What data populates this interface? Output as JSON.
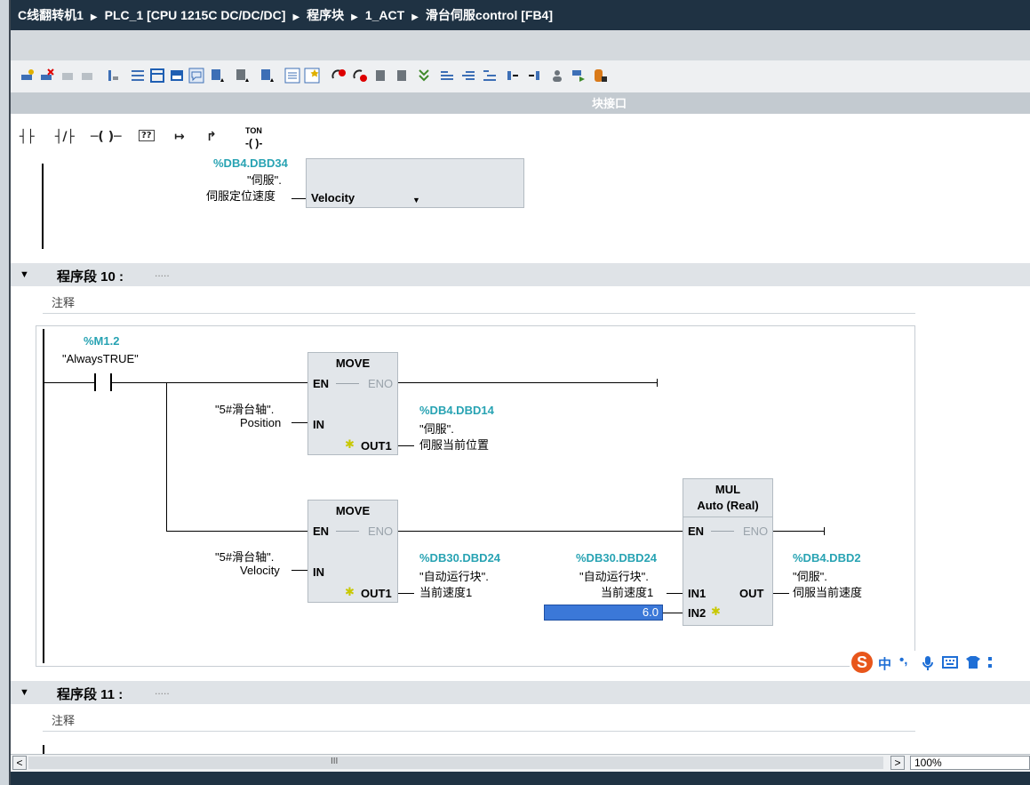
{
  "breadcrumb": {
    "project": "C线翻转机1",
    "plc": "PLC_1 [CPU 1215C DC/DC/DC]",
    "folder": "程序块",
    "group": "1_ACT",
    "block": "滑台伺服control [FB4]",
    "separator": "▶"
  },
  "interface_bar": {
    "label": "块接口"
  },
  "ladder_tools": {
    "no_contact": "┤├",
    "nc_contact": "┤/├",
    "coil": "─( )─",
    "empty_box": "??",
    "open_branch": "↦",
    "close_branch": "↱",
    "ton_label": "TON"
  },
  "network_prev": {
    "address": "%DB4.DBD34",
    "tag1": "\"伺服\".",
    "tag2": "伺服定位速度",
    "pin": "Velocity"
  },
  "network10": {
    "title": "程序段 10 :",
    "dots": ".....",
    "comment": "注释",
    "contact_addr": "%M1.2",
    "contact_tag": "\"AlwaysTRUE\"",
    "move1": {
      "name": "MOVE",
      "en": "EN",
      "eno": "ENO",
      "in": "IN",
      "out": "OUT1",
      "in_tag1": "\"5#滑台轴\".",
      "in_tag2": "Position",
      "out_addr": "%DB4.DBD14",
      "out_tag1": "\"伺服\".",
      "out_tag2": "伺服当前位置"
    },
    "move2": {
      "name": "MOVE",
      "en": "EN",
      "eno": "ENO",
      "in": "IN",
      "out": "OUT1",
      "in_tag1": "\"5#滑台轴\".",
      "in_tag2": "Velocity",
      "out_addr": "%DB30.DBD24",
      "out_tag1": "\"自动运行块\".",
      "out_tag2": "当前速度1"
    },
    "mul": {
      "name": "MUL",
      "type": "Auto (Real)",
      "en": "EN",
      "eno": "ENO",
      "in1": "IN1",
      "in2": "IN2",
      "out": "OUT",
      "in1_addr": "%DB30.DBD24",
      "in1_tag1": "\"自动运行块\".",
      "in1_tag2": "当前速度1",
      "in2_value": "6.0",
      "out_addr": "%DB4.DBD2",
      "out_tag1": "\"伺服\".",
      "out_tag2": "伺服当前速度"
    }
  },
  "network11": {
    "title": "程序段 11 :",
    "dots": ".....",
    "comment": "注释"
  },
  "ime": {
    "logo": "S",
    "lang": "中",
    "punct": "•,",
    "mic": "mic-icon"
  },
  "scroll": {
    "mid": "III",
    "zoom": "100%",
    "left_arrow": "<",
    "right_arrow": ">"
  },
  "colors": {
    "title_bg": "#1f3243",
    "address": "#28a3b3",
    "selected": "#3b78d8"
  }
}
